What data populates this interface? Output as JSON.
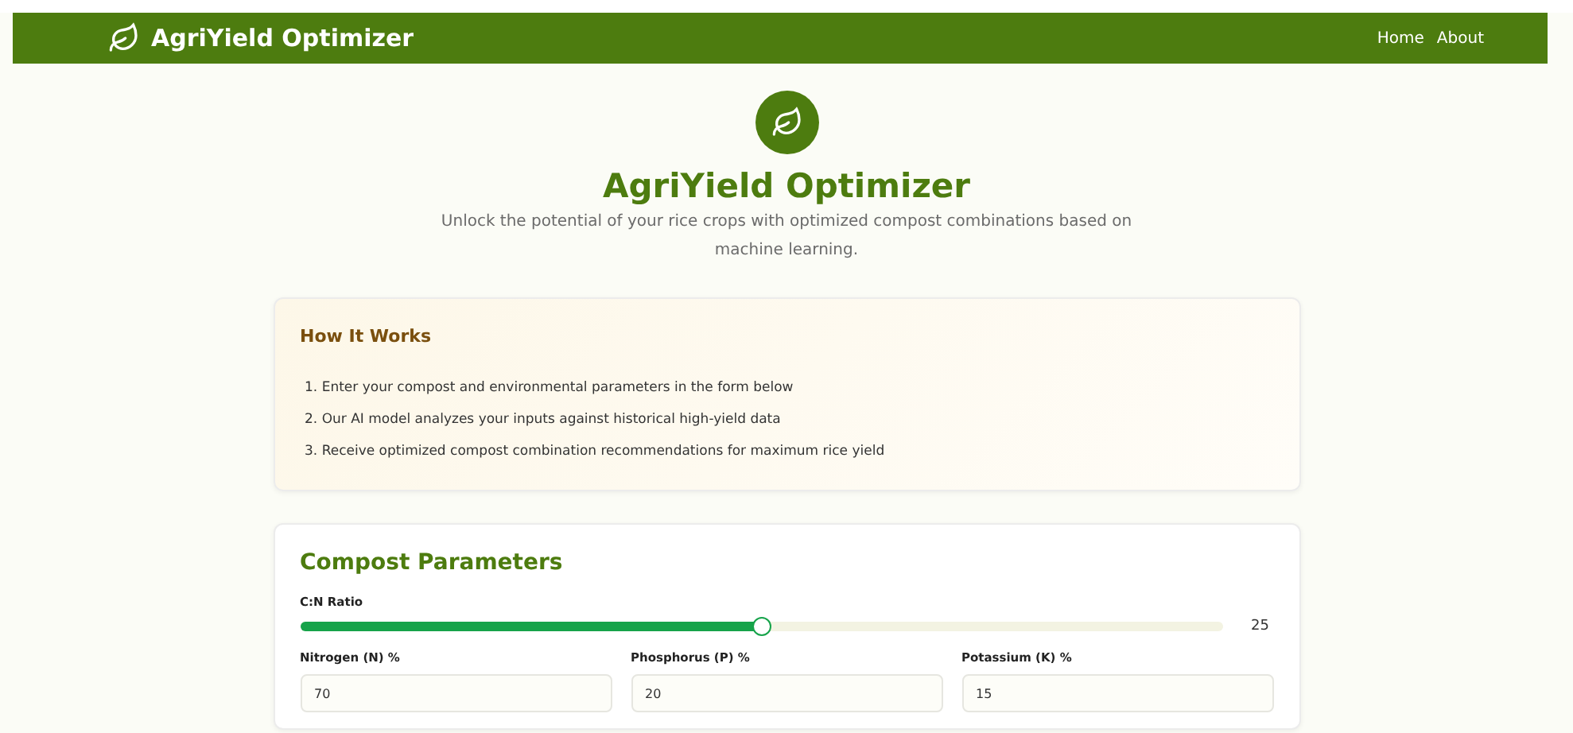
{
  "navbar": {
    "brand": "AgriYield Optimizer",
    "links": [
      "Home",
      "About"
    ]
  },
  "hero": {
    "title": "AgriYield Optimizer",
    "subtitle": "Unlock the potential of your rice crops with optimized compost combinations based on machine learning."
  },
  "how_it_works": {
    "title": "How It Works",
    "steps": [
      {
        "number": "1.",
        "text": "Enter your compost and environmental parameters in the form below"
      },
      {
        "number": "2.",
        "text": "Our AI model analyzes your inputs against historical high-yield data"
      },
      {
        "number": "3.",
        "text": "Receive optimized compost combination recommendations for maximum rice yield"
      }
    ]
  },
  "compost_parameters": {
    "title": "Compost Parameters",
    "slider": {
      "label": "C:N Ratio",
      "level": 0.5,
      "reading": "25"
    },
    "fields": [
      {
        "label": "Nitrogen (N) %",
        "value": "70"
      },
      {
        "label": "Phosphorus (P) %",
        "value": "20"
      },
      {
        "label": "Potassium (K) %",
        "value": "15"
      }
    ]
  }
}
